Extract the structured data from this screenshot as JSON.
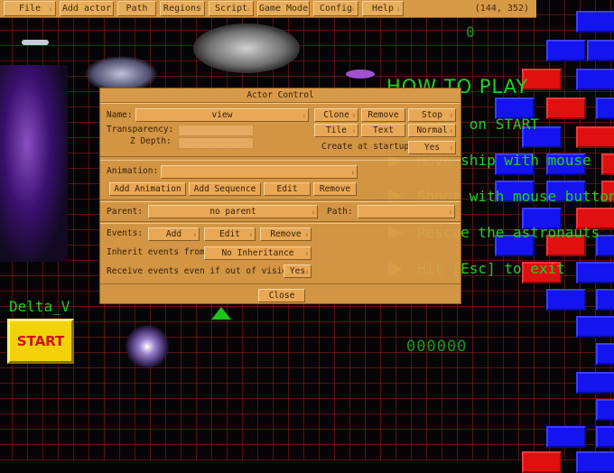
{
  "menubar": {
    "items": [
      {
        "label": "File"
      },
      {
        "label": "Add actor"
      },
      {
        "label": "Path"
      },
      {
        "label": "Regions"
      },
      {
        "label": "Script"
      },
      {
        "label": "Game Mode"
      },
      {
        "label": "Config"
      },
      {
        "label": "Help"
      }
    ],
    "coords": "(144, 352)"
  },
  "game": {
    "howto_title": "HOW TO PLAY",
    "howto_lines": [
      "Click on START",
      "Move ship with mouse",
      "Shoot with mouse button",
      "Rescue the astronauts",
      "Hit [Esc] to exit"
    ],
    "game_name": "Delta_V",
    "start_label": "START",
    "score": "000000",
    "lives": "0"
  },
  "dialog": {
    "title": "Actor Control",
    "name_label": "Name:",
    "name_value": "view",
    "clone": "Clone",
    "remove": "Remove",
    "stop": "Stop",
    "tile": "Tile",
    "text": "Text",
    "normal": "Normal",
    "transparency_label": "Transparency:",
    "zdepth_label": "Z Depth:",
    "create_startup_label": "Create at startup:",
    "create_startup_value": "Yes",
    "animation_label": "Animation:",
    "animation_value": "",
    "add_animation": "Add Animation",
    "add_sequence": "Add Sequence",
    "edit": "Edit",
    "anim_remove": "Remove",
    "parent_label": "Parent:",
    "parent_value": "no parent",
    "path_label": "Path:",
    "path_value": "",
    "events_label": "Events:",
    "events_add": "Add",
    "events_edit": "Edit",
    "events_remove": "Remove",
    "inherit_label": "Inherit events from:",
    "inherit_value": "No Inheritance",
    "receive_label": "Receive events even if out of vision:",
    "receive_value": "Yes",
    "close": "Close"
  }
}
